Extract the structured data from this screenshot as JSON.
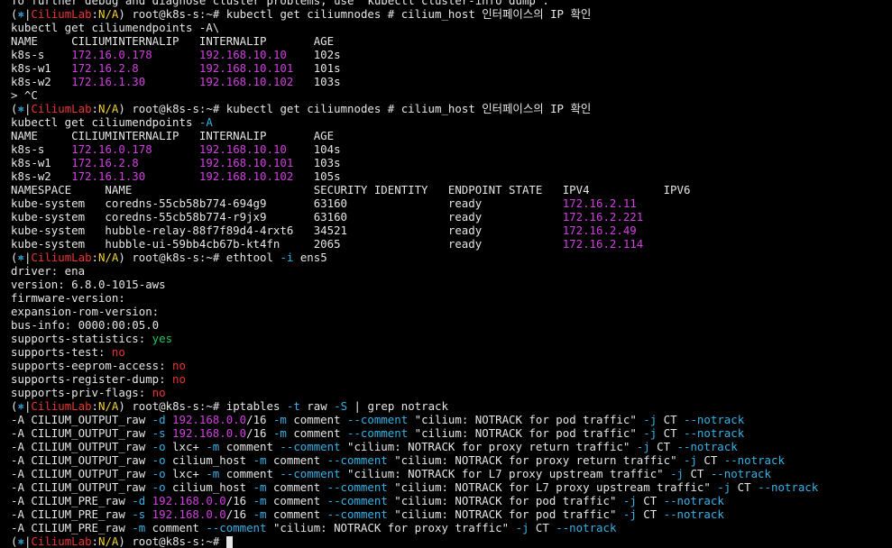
{
  "colors": {
    "n": "#e6e6e6",
    "m": "#d23fe0",
    "cy": "#36b2e6",
    "r": "#ea3434",
    "g": "#22c55e",
    "y": "#f0d038",
    "w": "#ffffff"
  },
  "lines": [
    [
      [
        "n",
        "To further debug and diagnose cluster problems, use 'kubectl cluster-info dump'."
      ]
    ],
    [
      [
        "n",
        "("
      ],
      [
        "cy",
        "⎈"
      ],
      [
        "n",
        "|"
      ],
      [
        "r",
        "CiliumLab"
      ],
      [
        "n",
        ":"
      ],
      [
        "y",
        "N/A"
      ],
      [
        "n",
        ") root@k8s-s:~# kubectl get ciliumnodes # cilium_host 인터페이스의 IP 확인"
      ]
    ],
    [
      [
        "n",
        "kubectl get ciliumendpoints -A\\"
      ]
    ],
    [
      [
        "n",
        "NAME     CILIUMINTERNALIP   INTERNALIP       AGE"
      ]
    ],
    [
      [
        "n",
        "k8s-s    "
      ],
      [
        "m",
        "172.16.0.178"
      ],
      [
        "n",
        "       "
      ],
      [
        "m",
        "192.168.10.10"
      ],
      [
        "n",
        "    102s"
      ]
    ],
    [
      [
        "n",
        "k8s-w1   "
      ],
      [
        "m",
        "172.16.2.8"
      ],
      [
        "n",
        "         "
      ],
      [
        "m",
        "192.168.10.101"
      ],
      [
        "n",
        "   101s"
      ]
    ],
    [
      [
        "n",
        "k8s-w2   "
      ],
      [
        "m",
        "172.16.1.30"
      ],
      [
        "n",
        "        "
      ],
      [
        "m",
        "192.168.10.102"
      ],
      [
        "n",
        "   103s"
      ]
    ],
    [
      [
        "n",
        "> ^C"
      ]
    ],
    [
      [
        "n",
        "("
      ],
      [
        "cy",
        "⎈"
      ],
      [
        "n",
        "|"
      ],
      [
        "r",
        "CiliumLab"
      ],
      [
        "n",
        ":"
      ],
      [
        "y",
        "N/A"
      ],
      [
        "n",
        ") root@k8s-s:~# kubectl get ciliumnodes # cilium_host 인터페이스의 IP 확인"
      ]
    ],
    [
      [
        "n",
        "kubectl get ciliumendpoints "
      ],
      [
        "cy",
        "-A"
      ]
    ],
    [
      [
        "n",
        "NAME     CILIUMINTERNALIP   INTERNALIP       AGE"
      ]
    ],
    [
      [
        "n",
        "k8s-s    "
      ],
      [
        "m",
        "172.16.0.178"
      ],
      [
        "n",
        "       "
      ],
      [
        "m",
        "192.168.10.10"
      ],
      [
        "n",
        "    104s"
      ]
    ],
    [
      [
        "n",
        "k8s-w1   "
      ],
      [
        "m",
        "172.16.2.8"
      ],
      [
        "n",
        "         "
      ],
      [
        "m",
        "192.168.10.101"
      ],
      [
        "n",
        "   103s"
      ]
    ],
    [
      [
        "n",
        "k8s-w2   "
      ],
      [
        "m",
        "172.16.1.30"
      ],
      [
        "n",
        "        "
      ],
      [
        "m",
        "192.168.10.102"
      ],
      [
        "n",
        "   105s"
      ]
    ],
    [
      [
        "n",
        "NAMESPACE     NAME                           SECURITY IDENTITY   ENDPOINT STATE   IPV4           IPV6"
      ]
    ],
    [
      [
        "n",
        "kube-system   coredns-55cb58b774-694g9       63160               ready            "
      ],
      [
        "m",
        "172.16.2.11"
      ]
    ],
    [
      [
        "n",
        "kube-system   coredns-55cb58b774-r9jx9       63160               ready            "
      ],
      [
        "m",
        "172.16.2.221"
      ]
    ],
    [
      [
        "n",
        "kube-system   hubble-relay-88f7f89d4-4rxt6   34521               ready            "
      ],
      [
        "m",
        "172.16.2.49"
      ]
    ],
    [
      [
        "n",
        "kube-system   hubble-ui-59bb4cb67b-kt4fn     2065                ready            "
      ],
      [
        "m",
        "172.16.2.114"
      ]
    ],
    [
      [
        "n",
        "("
      ],
      [
        "cy",
        "⎈"
      ],
      [
        "n",
        "|"
      ],
      [
        "r",
        "CiliumLab"
      ],
      [
        "n",
        ":"
      ],
      [
        "y",
        "N/A"
      ],
      [
        "n",
        ") root@k8s-s:~# ethtool "
      ],
      [
        "cy",
        "-i"
      ],
      [
        "n",
        " ens5"
      ]
    ],
    [
      [
        "n",
        "driver: ena"
      ]
    ],
    [
      [
        "n",
        "version: 6.8.0-1015-aws"
      ]
    ],
    [
      [
        "n",
        "firmware-version:"
      ]
    ],
    [
      [
        "n",
        "expansion-rom-version:"
      ]
    ],
    [
      [
        "n",
        "bus-info: 0000:00:05.0"
      ]
    ],
    [
      [
        "n",
        "supports-statistics: "
      ],
      [
        "g",
        "yes"
      ]
    ],
    [
      [
        "n",
        "supports-test: "
      ],
      [
        "r",
        "no"
      ]
    ],
    [
      [
        "n",
        "supports-eeprom-access: "
      ],
      [
        "r",
        "no"
      ]
    ],
    [
      [
        "n",
        "supports-register-dump: "
      ],
      [
        "r",
        "no"
      ]
    ],
    [
      [
        "n",
        "supports-priv-flags: "
      ],
      [
        "r",
        "no"
      ]
    ],
    [
      [
        "n",
        "("
      ],
      [
        "cy",
        "⎈"
      ],
      [
        "n",
        "|"
      ],
      [
        "r",
        "CiliumLab"
      ],
      [
        "n",
        ":"
      ],
      [
        "y",
        "N/A"
      ],
      [
        "n",
        ") root@k8s-s:~# iptables "
      ],
      [
        "cy",
        "-t"
      ],
      [
        "n",
        " raw "
      ],
      [
        "cy",
        "-S"
      ],
      [
        "n",
        " | grep notrack"
      ]
    ],
    [
      [
        "n",
        "-A CILIUM_OUTPUT_raw "
      ],
      [
        "cy",
        "-d"
      ],
      [
        "n",
        " "
      ],
      [
        "m",
        "192.168.0.0"
      ],
      [
        "n",
        "/16 "
      ],
      [
        "cy",
        "-m"
      ],
      [
        "n",
        " comment "
      ],
      [
        "cy",
        "--comment"
      ],
      [
        "n",
        " \"cilium: NOTRACK for pod traffic\" "
      ],
      [
        "cy",
        "-j"
      ],
      [
        "n",
        " CT "
      ],
      [
        "cy",
        "--notrack"
      ]
    ],
    [
      [
        "n",
        "-A CILIUM_OUTPUT_raw "
      ],
      [
        "cy",
        "-s"
      ],
      [
        "n",
        " "
      ],
      [
        "m",
        "192.168.0.0"
      ],
      [
        "n",
        "/16 "
      ],
      [
        "cy",
        "-m"
      ],
      [
        "n",
        " comment "
      ],
      [
        "cy",
        "--comment"
      ],
      [
        "n",
        " \"cilium: NOTRACK for pod traffic\" "
      ],
      [
        "cy",
        "-j"
      ],
      [
        "n",
        " CT "
      ],
      [
        "cy",
        "--notrack"
      ]
    ],
    [
      [
        "n",
        "-A CILIUM_OUTPUT_raw "
      ],
      [
        "cy",
        "-o"
      ],
      [
        "n",
        " lxc+ "
      ],
      [
        "cy",
        "-m"
      ],
      [
        "n",
        " comment "
      ],
      [
        "cy",
        "--comment"
      ],
      [
        "n",
        " \"cilium: NOTRACK for proxy return traffic\" "
      ],
      [
        "cy",
        "-j"
      ],
      [
        "n",
        " CT "
      ],
      [
        "cy",
        "--notrack"
      ]
    ],
    [
      [
        "n",
        "-A CILIUM_OUTPUT_raw "
      ],
      [
        "cy",
        "-o"
      ],
      [
        "n",
        " cilium_host "
      ],
      [
        "cy",
        "-m"
      ],
      [
        "n",
        " comment "
      ],
      [
        "cy",
        "--comment"
      ],
      [
        "n",
        " \"cilium: NOTRACK for proxy return traffic\" "
      ],
      [
        "cy",
        "-j"
      ],
      [
        "n",
        " CT "
      ],
      [
        "cy",
        "--notrack"
      ]
    ],
    [
      [
        "n",
        "-A CILIUM_OUTPUT_raw "
      ],
      [
        "cy",
        "-o"
      ],
      [
        "n",
        " lxc+ "
      ],
      [
        "cy",
        "-m"
      ],
      [
        "n",
        " comment "
      ],
      [
        "cy",
        "--comment"
      ],
      [
        "n",
        " \"cilium: NOTRACK for L7 proxy upstream traffic\" "
      ],
      [
        "cy",
        "-j"
      ],
      [
        "n",
        " CT "
      ],
      [
        "cy",
        "--notrack"
      ]
    ],
    [
      [
        "n",
        "-A CILIUM_OUTPUT_raw "
      ],
      [
        "cy",
        "-o"
      ],
      [
        "n",
        " cilium_host "
      ],
      [
        "cy",
        "-m"
      ],
      [
        "n",
        " comment "
      ],
      [
        "cy",
        "--comment"
      ],
      [
        "n",
        " \"cilium: NOTRACK for L7 proxy upstream traffic\" "
      ],
      [
        "cy",
        "-j"
      ],
      [
        "n",
        " CT "
      ],
      [
        "cy",
        "--notrack"
      ]
    ],
    [
      [
        "n",
        "-A CILIUM_PRE_raw "
      ],
      [
        "cy",
        "-d"
      ],
      [
        "n",
        " "
      ],
      [
        "m",
        "192.168.0.0"
      ],
      [
        "n",
        "/16 "
      ],
      [
        "cy",
        "-m"
      ],
      [
        "n",
        " comment "
      ],
      [
        "cy",
        "--comment"
      ],
      [
        "n",
        " \"cilium: NOTRACK for pod traffic\" "
      ],
      [
        "cy",
        "-j"
      ],
      [
        "n",
        " CT "
      ],
      [
        "cy",
        "--notrack"
      ]
    ],
    [
      [
        "n",
        "-A CILIUM_PRE_raw "
      ],
      [
        "cy",
        "-s"
      ],
      [
        "n",
        " "
      ],
      [
        "m",
        "192.168.0.0"
      ],
      [
        "n",
        "/16 "
      ],
      [
        "cy",
        "-m"
      ],
      [
        "n",
        " comment "
      ],
      [
        "cy",
        "--comment"
      ],
      [
        "n",
        " \"cilium: NOTRACK for pod traffic\" "
      ],
      [
        "cy",
        "-j"
      ],
      [
        "n",
        " CT "
      ],
      [
        "cy",
        "--notrack"
      ]
    ],
    [
      [
        "n",
        "-A CILIUM_PRE_raw "
      ],
      [
        "cy",
        "-m"
      ],
      [
        "n",
        " comment "
      ],
      [
        "cy",
        "--comment"
      ],
      [
        "n",
        " \"cilium: NOTRACK for proxy traffic\" "
      ],
      [
        "cy",
        "-j"
      ],
      [
        "n",
        " CT "
      ],
      [
        "cy",
        "--notrack"
      ]
    ],
    [
      [
        "n",
        "("
      ],
      [
        "cy",
        "⎈"
      ],
      [
        "n",
        "|"
      ],
      [
        "r",
        "CiliumLab"
      ],
      [
        "n",
        ":"
      ],
      [
        "y",
        "N/A"
      ],
      [
        "n",
        ") root@k8s-s:~# "
      ],
      [
        "cursor",
        ""
      ]
    ]
  ]
}
